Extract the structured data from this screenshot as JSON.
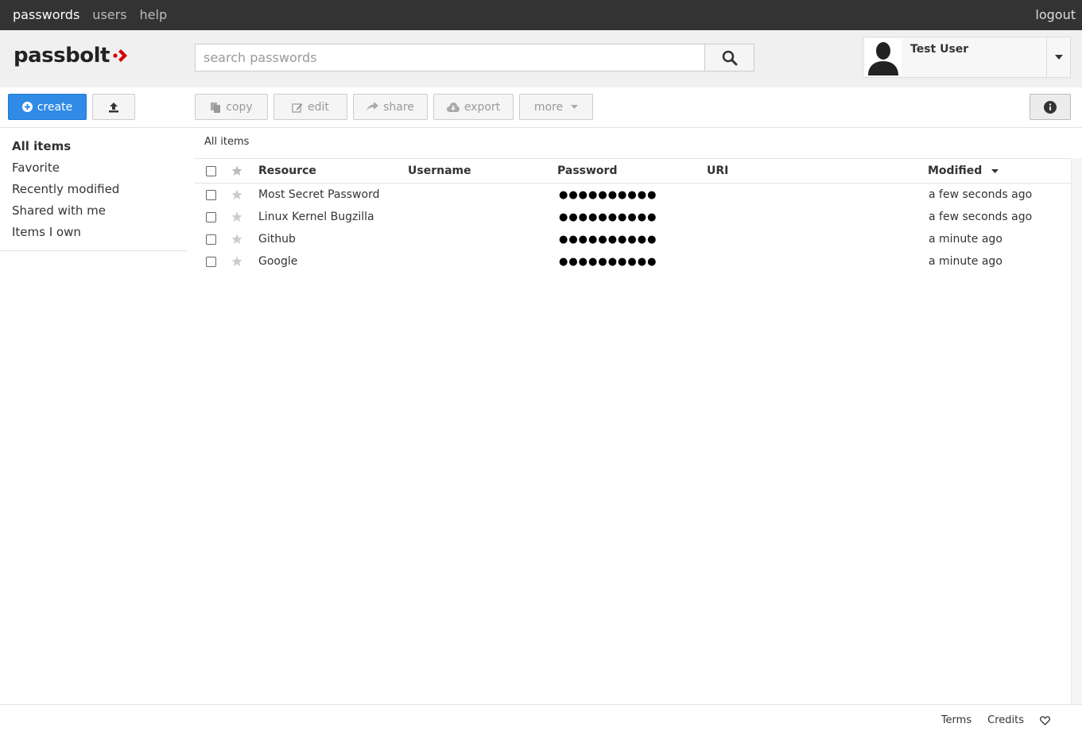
{
  "topnav": {
    "items": [
      "passwords",
      "users",
      "help"
    ],
    "logout": "logout"
  },
  "logo": {
    "text": "passbolt"
  },
  "search": {
    "placeholder": "search passwords"
  },
  "user": {
    "name": "Test User"
  },
  "toolbar": {
    "create": "create",
    "copy": "copy",
    "edit": "edit",
    "share": "share",
    "export": "export",
    "more": "more"
  },
  "sidebar": {
    "items": [
      "All items",
      "Favorite",
      "Recently modified",
      "Shared with me",
      "Items I own"
    ]
  },
  "breadcrumb": "All items",
  "grid": {
    "columns": {
      "resource": "Resource",
      "username": "Username",
      "password": "Password",
      "uri": "URI",
      "modified": "Modified"
    },
    "rows": [
      {
        "resource": "Most Secret Password",
        "username": "",
        "password": "●●●●●●●●●●",
        "uri": "",
        "modified": "a few seconds ago"
      },
      {
        "resource": "Linux Kernel Bugzilla",
        "username": "",
        "password": "●●●●●●●●●●",
        "uri": "",
        "modified": "a few seconds ago"
      },
      {
        "resource": "Github",
        "username": "",
        "password": "●●●●●●●●●●",
        "uri": "",
        "modified": "a minute ago"
      },
      {
        "resource": "Google",
        "username": "",
        "password": "●●●●●●●●●●",
        "uri": "",
        "modified": "a minute ago"
      }
    ]
  },
  "footer": {
    "terms": "Terms",
    "credits": "Credits"
  },
  "colors": {
    "primary": "#2f8be6",
    "topbar": "#333333",
    "logo_accent": "#d40101"
  }
}
